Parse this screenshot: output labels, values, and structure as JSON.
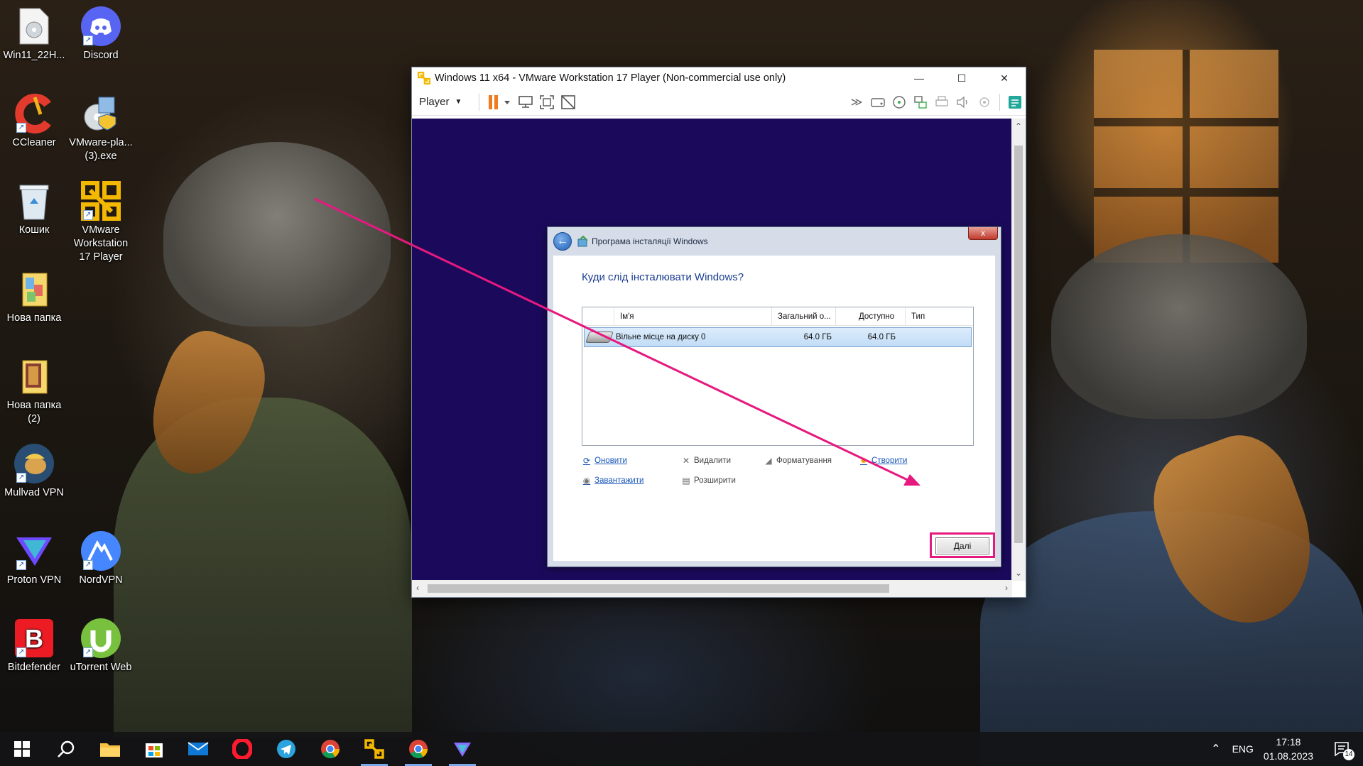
{
  "desktop": {
    "icons": [
      {
        "label": "Win11_22H...",
        "icon": "disc-image-icon"
      },
      {
        "label": "Discord",
        "icon": "discord-icon"
      },
      {
        "label": "CCleaner",
        "icon": "ccleaner-icon"
      },
      {
        "label": "VMware-pla... (3).exe",
        "icon": "installer-icon"
      },
      {
        "label": "Кошик",
        "icon": "recycle-bin-icon"
      },
      {
        "label": "VMware Workstation 17 Player",
        "icon": "vmware-icon"
      },
      {
        "label": "Нова папка",
        "icon": "folder-icon"
      },
      {
        "label": "Нова папка (2)",
        "icon": "folder-icon"
      },
      {
        "label": "Mullvad VPN",
        "icon": "mullvad-icon"
      },
      {
        "label": "Proton VPN",
        "icon": "protonvpn-icon"
      },
      {
        "label": "NordVPN",
        "icon": "nordvpn-icon"
      },
      {
        "label": "Bitdefender",
        "icon": "bitdefender-icon"
      },
      {
        "label": "uTorrent Web",
        "icon": "utorrent-icon"
      }
    ]
  },
  "vmware": {
    "title": "Windows 11 x64 - VMware Workstation 17 Player (Non-commercial use only)",
    "menu_player": "Player",
    "controls": {
      "minimize": "—",
      "maximize": "☐",
      "close": "✕"
    }
  },
  "setup": {
    "title": "Програма інсталяції Windows",
    "question": "Куди слід інсталювати Windows?",
    "columns": [
      "Ім'я",
      "Загальний о...",
      "Доступно",
      "Тип"
    ],
    "rows": [
      {
        "name": "Вільне місце на диску 0",
        "total": "64.0 ГБ",
        "free": "64.0 ГБ",
        "type": ""
      }
    ],
    "actions": {
      "refresh": "Оновити",
      "delete": "Видалити",
      "format": "Форматування",
      "new": "Створити",
      "load": "Завантажити",
      "extend": "Розширити"
    },
    "next": "Далі",
    "close": "x"
  },
  "annotation": {
    "color": "#e6197f"
  },
  "taskbar": {
    "apps": [
      "start-icon",
      "search-icon",
      "file-explorer-icon",
      "store-icon",
      "mail-icon",
      "opera-icon",
      "telegram-icon",
      "chrome-icon",
      "vmware-icon",
      "chrome-icon",
      "protonvpn-icon"
    ],
    "language": "ENG",
    "time": "17:18",
    "date": "01.08.2023",
    "notifications": "14"
  }
}
